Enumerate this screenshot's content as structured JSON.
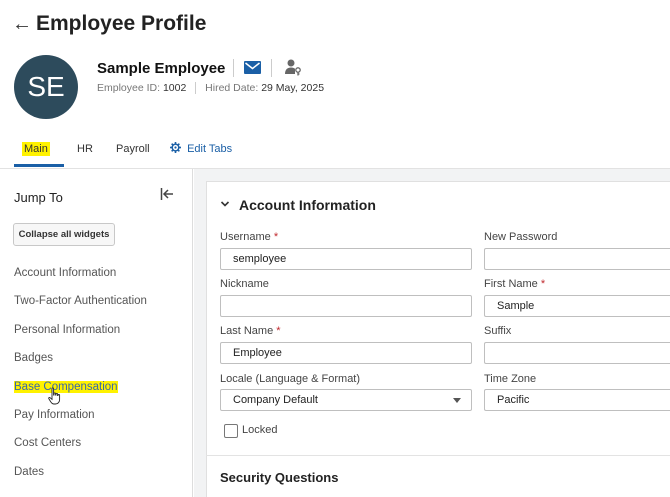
{
  "header": {
    "title": "Employee Profile"
  },
  "employee": {
    "initials": "SE",
    "name": "Sample Employee",
    "id_label": "Employee ID:",
    "id_value": "1002",
    "hired_label": "Hired Date:",
    "hired_value": "29 May, 2025"
  },
  "tabs": [
    {
      "label": "Main",
      "selected": true
    },
    {
      "label": "HR"
    },
    {
      "label": "Payroll"
    },
    {
      "label": "Edit Tabs"
    }
  ],
  "sidebar": {
    "title": "Jump To",
    "collapse_label": "Collapse all widgets",
    "items": [
      {
        "label": "Account Information"
      },
      {
        "label": "Two-Factor Authentication"
      },
      {
        "label": "Personal Information"
      },
      {
        "label": "Badges"
      },
      {
        "label": "Base Compensation",
        "active": true
      },
      {
        "label": "Pay Information"
      },
      {
        "label": "Cost Centers"
      },
      {
        "label": "Dates"
      }
    ]
  },
  "account": {
    "section_title": "Account Information",
    "username_label": "Username",
    "username_value": "semployee",
    "new_password_label": "New Password",
    "new_password_value": "",
    "nickname_label": "Nickname",
    "nickname_value": "",
    "first_name_label": "First Name",
    "first_name_value": "Sample",
    "last_name_label": "Last Name",
    "last_name_value": "Employee",
    "suffix_label": "Suffix",
    "suffix_value": "",
    "locale_label": "Locale (Language & Format)",
    "locale_value": "Company Default",
    "timezone_label": "Time Zone",
    "timezone_value": "Pacific",
    "locked_label": "Locked",
    "required_mark": "*"
  },
  "security": {
    "title": "Security Questions"
  },
  "colors": {
    "accent": "#1a5fa6",
    "highlight": "#fff200",
    "avatar_bg": "#2d4b5c",
    "required": "#c0282d"
  }
}
